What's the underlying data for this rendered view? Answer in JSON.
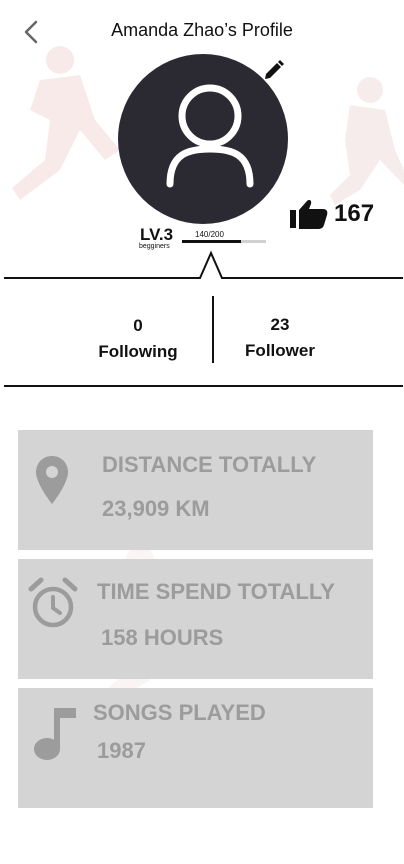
{
  "header": {
    "title": "Amanda Zhao’s Profile"
  },
  "profile": {
    "likes": "167",
    "level": "LV.3",
    "level_name": "begginers",
    "progress_text": "140/200",
    "progress_fraction": 0.7
  },
  "stats": {
    "following_count": "0",
    "following_label": "Following",
    "follower_count": "23",
    "follower_label": "Follower"
  },
  "cards": [
    {
      "label": "DISTANCE TOTALLY",
      "value": "23,909 KM",
      "icon": "location-pin-icon"
    },
    {
      "label": "TIME SPEND TOTALLY",
      "value": "158 HOURS",
      "icon": "alarm-clock-icon"
    },
    {
      "label": "SONGS PLAYED",
      "value": "1987",
      "icon": "music-note-icon"
    }
  ],
  "colors": {
    "avatar_bg": "#2b2a33",
    "card_bg": "#d4d4d4",
    "card_text": "#9c9c9c"
  }
}
